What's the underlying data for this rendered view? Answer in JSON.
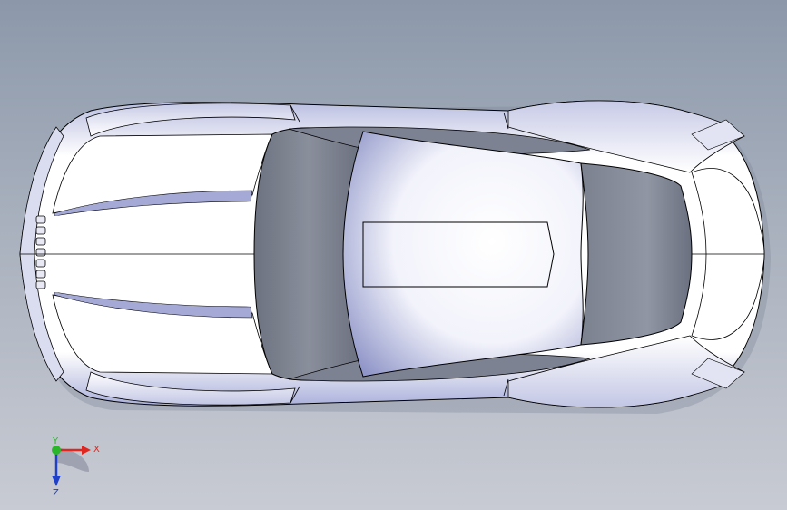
{
  "viewport": {
    "background_top": "#8C98AA",
    "background_bottom": "#C8CBD3"
  },
  "model": {
    "icon": "car-body-top-view",
    "body_color": "#FFFFFF",
    "shade_color": "#8E95C4",
    "edge_color": "#000000"
  },
  "triad": {
    "x_label": "X",
    "y_label": "Y",
    "z_label": "Z",
    "x_color": "#E0261E",
    "y_color": "#2BB52B",
    "z_color": "#2040C8"
  }
}
